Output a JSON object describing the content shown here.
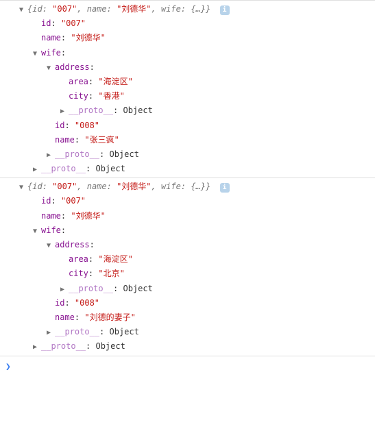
{
  "entries": [
    {
      "preview": {
        "id_key": "id",
        "id_val": "\"007\"",
        "name_key": "name",
        "name_val": "\"刘德华\"",
        "wife_key": "wife",
        "wife_val": "{…}"
      },
      "info_badge": "i",
      "props": {
        "id_key": "id",
        "id_val": "\"007\"",
        "name_key": "name",
        "name_val": "\"刘德华\"",
        "wife_key": "wife",
        "address_key": "address",
        "area_key": "area",
        "area_val": "\"海淀区\"",
        "city_key": "city",
        "city_val": "\"香港\"",
        "wife_id_key": "id",
        "wife_id_val": "\"008\"",
        "wife_name_key": "name",
        "wife_name_val": "\"张三疯\"",
        "proto_key": "__proto__",
        "proto_type": "Object"
      }
    },
    {
      "preview": {
        "id_key": "id",
        "id_val": "\"007\"",
        "name_key": "name",
        "name_val": "\"刘德华\"",
        "wife_key": "wife",
        "wife_val": "{…}"
      },
      "info_badge": "i",
      "props": {
        "id_key": "id",
        "id_val": "\"007\"",
        "name_key": "name",
        "name_val": "\"刘德华\"",
        "wife_key": "wife",
        "address_key": "address",
        "area_key": "area",
        "area_val": "\"海淀区\"",
        "city_key": "city",
        "city_val": "\"北京\"",
        "wife_id_key": "id",
        "wife_id_val": "\"008\"",
        "wife_name_key": "name",
        "wife_name_val": "\"刘德的妻子\"",
        "proto_key": "__proto__",
        "proto_type": "Object"
      }
    }
  ],
  "prompt": "❯"
}
